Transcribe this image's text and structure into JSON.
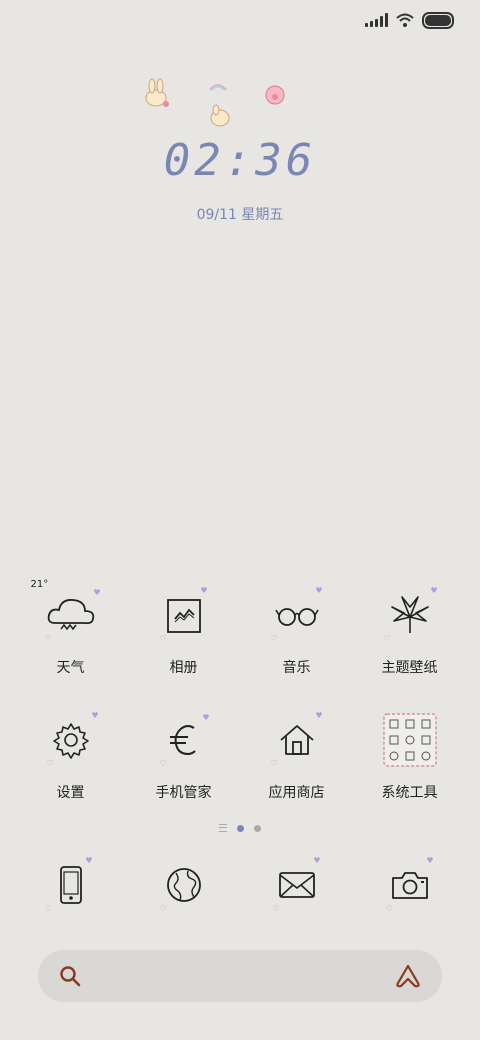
{
  "status_bar": {
    "icons": [
      "signal-icon",
      "wifi-icon",
      "battery-icon"
    ]
  },
  "lockscreen": {
    "time": "02:36",
    "date": "09/11 星期五"
  },
  "weather": {
    "temp": "21°"
  },
  "apps_row1": [
    {
      "label": "天气",
      "icon": "weather-cloud-icon"
    },
    {
      "label": "相册",
      "icon": "gallery-icon"
    },
    {
      "label": "音乐",
      "icon": "glasses-icon"
    },
    {
      "label": "主题壁纸",
      "icon": "leaf-icon"
    }
  ],
  "apps_row2": [
    {
      "label": "设置",
      "icon": "gear-icon"
    },
    {
      "label": "手机管家",
      "icon": "euro-icon"
    },
    {
      "label": "应用商店",
      "icon": "house-icon"
    },
    {
      "label": "系统工具",
      "icon": "tools-folder-icon"
    }
  ],
  "dock": [
    {
      "icon": "phone-icon"
    },
    {
      "icon": "globe-icon"
    },
    {
      "icon": "mail-icon"
    },
    {
      "icon": "camera-icon"
    }
  ],
  "page_indicator": {
    "pages": 2,
    "current": 1
  },
  "search": {
    "icons": [
      "search-icon",
      "assistant-icon"
    ]
  },
  "colors": {
    "accent": "#7a86b4",
    "background": "#e7e6e2",
    "heart": "#b39be0"
  }
}
